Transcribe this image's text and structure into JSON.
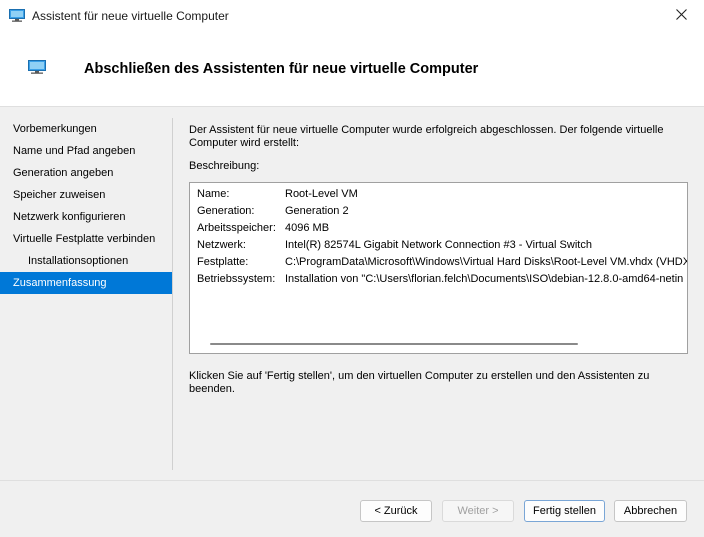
{
  "window": {
    "title": "Assistent für neue virtuelle Computer"
  },
  "header": {
    "title": "Abschließen des Assistenten für neue virtuelle Computer"
  },
  "nav": {
    "items": [
      {
        "label": "Vorbemerkungen"
      },
      {
        "label": "Name und Pfad angeben"
      },
      {
        "label": "Generation angeben"
      },
      {
        "label": "Speicher zuweisen"
      },
      {
        "label": "Netzwerk konfigurieren"
      },
      {
        "label": "Virtuelle Festplatte verbinden"
      },
      {
        "label": "Installationsoptionen"
      },
      {
        "label": "Zusammenfassung"
      }
    ],
    "active_index": 7
  },
  "main": {
    "intro": "Der Assistent für neue virtuelle Computer wurde erfolgreich abgeschlossen. Der folgende virtuelle Computer wird erstellt:",
    "description_label": "Beschreibung:",
    "summary": [
      {
        "label": "Name:",
        "value": "Root-Level VM"
      },
      {
        "label": "Generation:",
        "value": "Generation 2"
      },
      {
        "label": "Arbeitsspeicher:",
        "value": "4096 MB"
      },
      {
        "label": "Netzwerk:",
        "value": "Intel(R) 82574L Gigabit Network Connection #3 - Virtual Switch"
      },
      {
        "label": "Festplatte:",
        "value": "C:\\ProgramData\\Microsoft\\Windows\\Virtual Hard Disks\\Root-Level VM.vhdx (VHDX,"
      },
      {
        "label": "Betriebssystem:",
        "value": "Installation von \"C:\\Users\\florian.felch\\Documents\\ISO\\debian-12.8.0-amd64-netin"
      }
    ],
    "footer_text": "Klicken Sie auf 'Fertig stellen', um den virtuellen Computer zu erstellen und den Assistenten zu beenden."
  },
  "buttons": {
    "back": "< Zurück",
    "next": "Weiter >",
    "finish": "Fertig stellen",
    "cancel": "Abbrechen"
  },
  "colors": {
    "accent": "#0078d7"
  }
}
